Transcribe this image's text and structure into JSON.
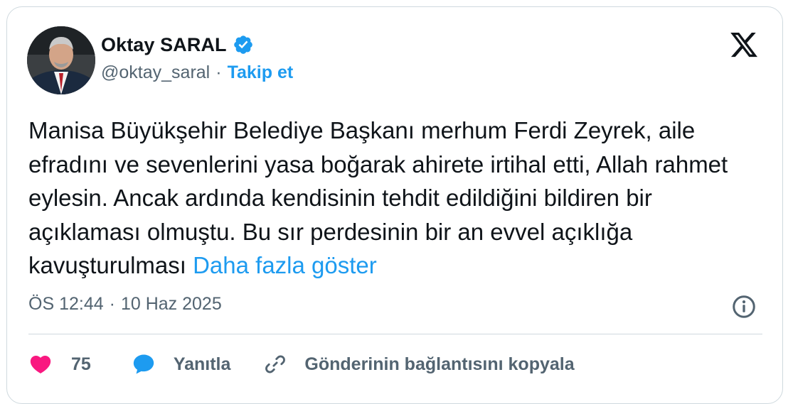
{
  "author": {
    "display_name": "Oktay SARAL",
    "handle": "@oktay_saral",
    "separator": "·",
    "follow_label": "Takip et"
  },
  "tweet": {
    "text": "Manisa Büyükşehir Belediye Başkanı merhum Ferdi Zeyrek, aile efradını ve sevenlerini yasa boğarak ahirete irtihal etti, Allah rahmet eylesin. Ancak ardında kendisinin tehdit edildiğini bildiren bir açıklaması olmuştu. Bu sır perdesinin bir an evvel açıklığa kavuşturulması",
    "show_more_label": "Daha fazla göster",
    "time": "ÖS 12:44",
    "separator": "·",
    "date": "10 Haz 2025"
  },
  "actions": {
    "like_count": "75",
    "reply_label": "Yanıtla",
    "copy_link_label": "Gönderinin bağlantısını kopyala"
  },
  "colors": {
    "accent": "#1d9bf0",
    "like": "#f91880",
    "secondary_text": "#536471",
    "border": "#cfd9de"
  },
  "icons": {
    "verified": "verified-badge-icon",
    "brand": "x-logo-icon",
    "info": "info-icon",
    "like": "heart-icon",
    "reply": "speech-bubble-icon",
    "copy": "link-icon"
  }
}
